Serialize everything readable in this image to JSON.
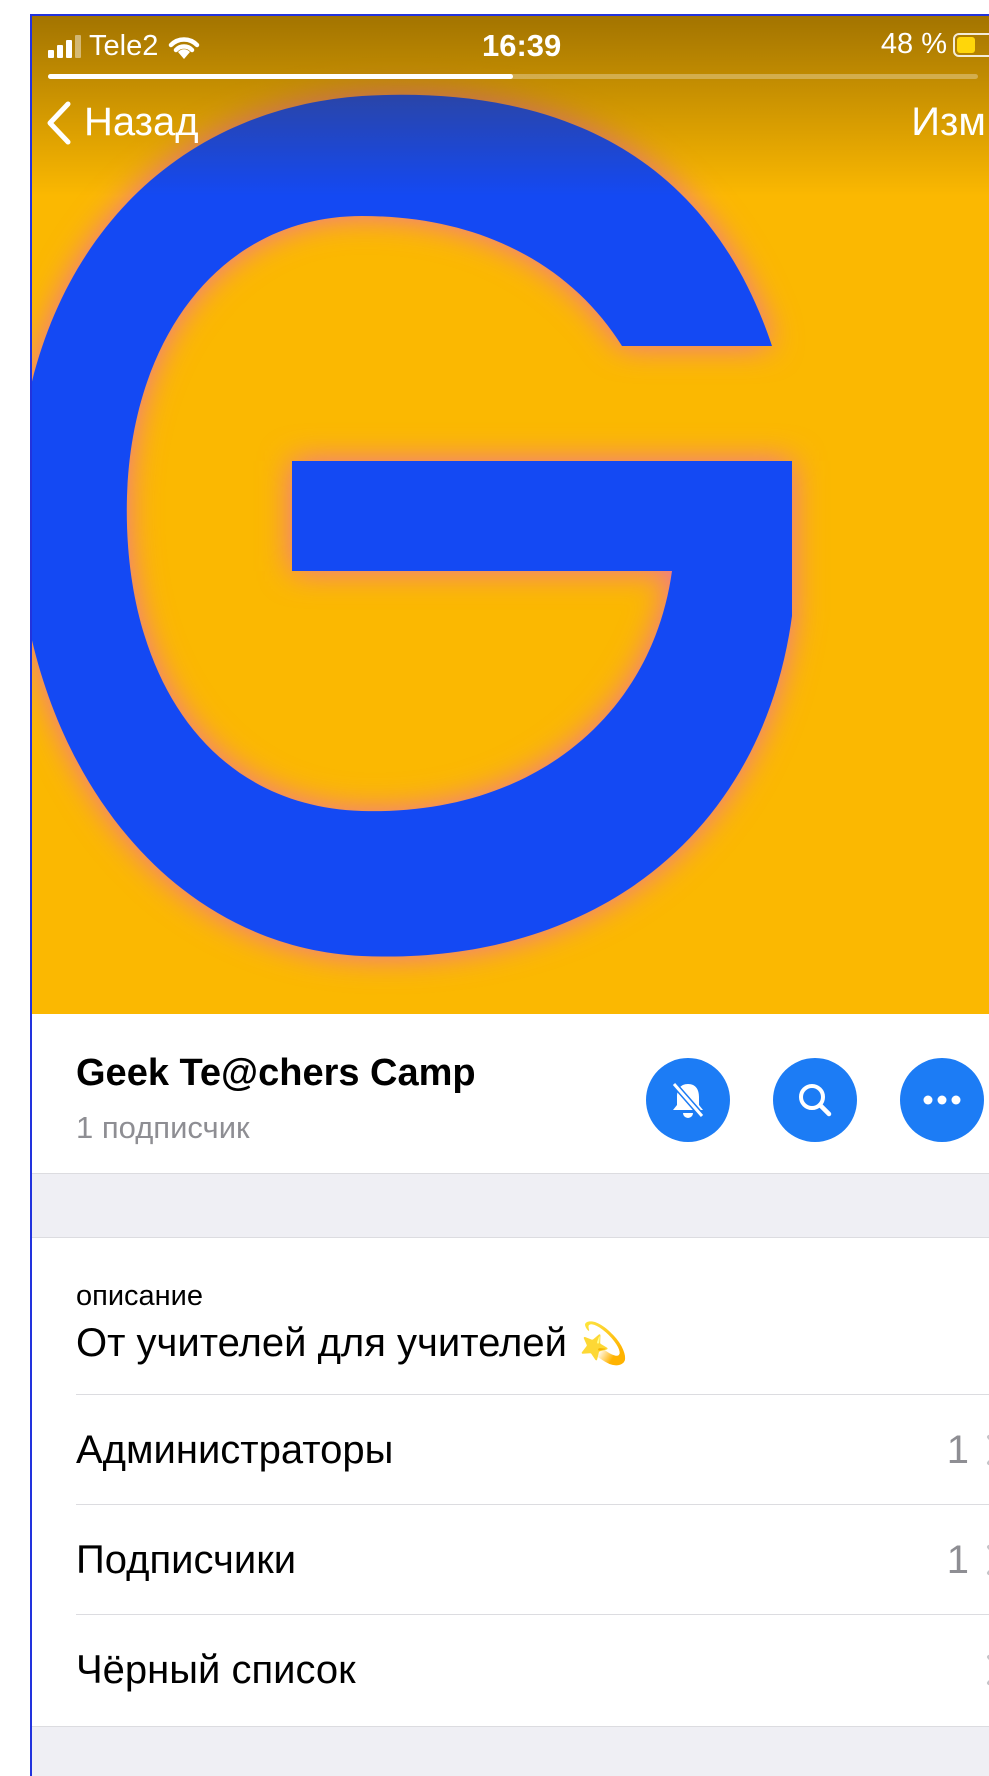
{
  "status_bar": {
    "carrier": "Tele2",
    "time": "16:39",
    "battery_text": "48 %",
    "battery_level": 0.48,
    "signal_icon": "cellular-signal-icon",
    "wifi_icon": "wifi-icon"
  },
  "story_progress": 0.5,
  "nav": {
    "back_label": "Назад",
    "edit_label": "Изм."
  },
  "channel": {
    "title": "Geek Te@chers Camp",
    "subscribers": "1 подписчик",
    "actions": [
      "mute-bell-icon",
      "search-icon",
      "more-icon"
    ],
    "accent": "#1c7cf5"
  },
  "cover": {
    "logo_icon": "letter-g-logo",
    "background": "#fbb801",
    "logo_color": "#1449f3",
    "glow_color": "#ef6f9e"
  },
  "info": {
    "description_label": "описание",
    "description_text": "От учителей для учителей",
    "description_emoji": "💫"
  },
  "rows": [
    {
      "label": "Администраторы",
      "count": "1"
    },
    {
      "label": "Подписчики",
      "count": "1"
    },
    {
      "label": "Чёрный список",
      "count": ""
    }
  ]
}
